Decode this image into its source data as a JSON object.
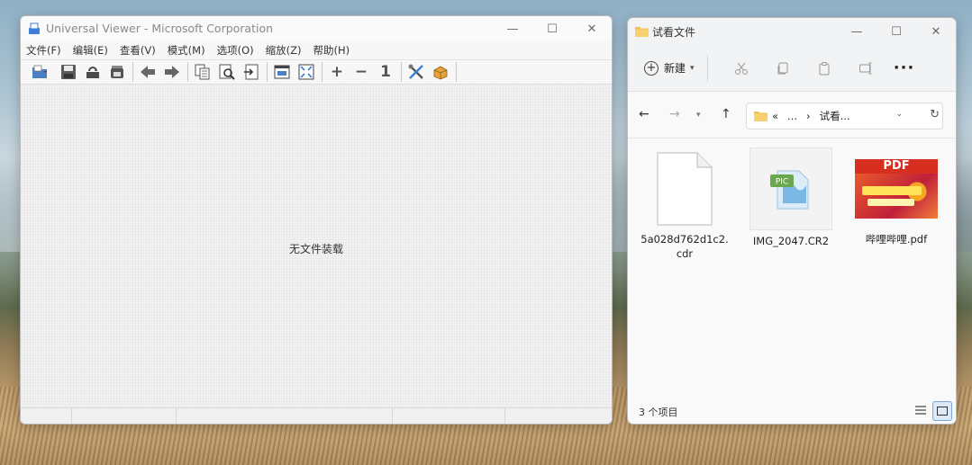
{
  "viewer": {
    "title": "Universal Viewer - Microsoft Corporation",
    "menu": [
      "文件(F)",
      "编辑(E)",
      "查看(V)",
      "模式(M)",
      "选项(O)",
      "缩放(Z)",
      "帮助(H)"
    ],
    "toolbar_icons": [
      "open-icon",
      "save-icon",
      "reload-icon",
      "print-icon",
      "prev-icon",
      "next-icon",
      "copy-icon",
      "find-icon",
      "export-icon",
      "window-icon",
      "fullscreen-icon",
      "zoom-in-icon",
      "zoom-out-icon",
      "zoom-1-icon",
      "tools-icon",
      "plugin-icon"
    ],
    "zoom_in_label": "+",
    "zoom_out_label": "−",
    "zoom_one_label": "1",
    "empty_message": "无文件装载"
  },
  "explorer": {
    "title": "试看文件",
    "new_label": "新建",
    "more_label": "···",
    "breadcrumb": [
      "«",
      "...",
      "›",
      "试看..."
    ],
    "files": [
      {
        "name": "5a028d762d1c2.cdr",
        "icon": "blank-file-icon"
      },
      {
        "name": "IMG_2047.CR2",
        "icon": "pic-file-icon"
      },
      {
        "name": "哔哩哔哩.pdf",
        "icon": "pdf-thumbnail"
      }
    ],
    "pic_badge": "PIC",
    "pdf_badge": "PDF",
    "status_count": "3 个项目"
  },
  "colors": {
    "folder": "#f2c14e",
    "pdf_red": "#d62e1f",
    "accent_blue": "#7aa7d6"
  }
}
